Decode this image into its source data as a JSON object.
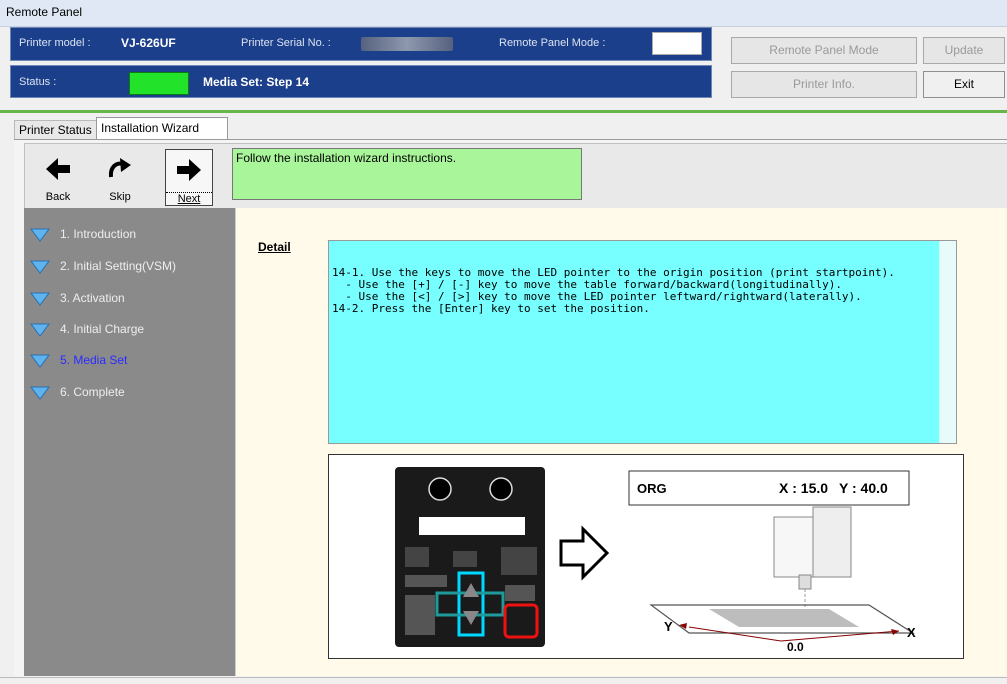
{
  "window": {
    "title": "Remote Panel"
  },
  "header": {
    "printer_model_label": "Printer model :",
    "printer_model_value": "VJ-626UF",
    "serial_label": "Printer Serial No. :",
    "remote_mode_label": "Remote Panel Mode :",
    "status_label": "Status :",
    "status_text": "Media Set: Step 14",
    "status_color": "#22e22a"
  },
  "buttons": {
    "remote_panel_mode": "Remote Panel Mode",
    "update": "Update",
    "printer_info": "Printer Info.",
    "exit": "Exit"
  },
  "tabs": [
    {
      "label": "Printer Status"
    },
    {
      "label": "Installation Wizard"
    }
  ],
  "nav": {
    "back": "Back",
    "skip": "Skip",
    "next": "Next",
    "instruction": "Follow the installation wizard instructions."
  },
  "steps": [
    {
      "label": "1. Introduction"
    },
    {
      "label": "2. Initial Setting(VSM)"
    },
    {
      "label": "3. Activation"
    },
    {
      "label": "4. Initial Charge"
    },
    {
      "label": "5. Media Set"
    },
    {
      "label": "6. Complete"
    }
  ],
  "detail": {
    "heading": "Detail",
    "text": "14-1. Use the keys to move the LED pointer to the origin position (print startpoint).\n  - Use the [+] / [-] key to move the table forward/backward(longitudinally).\n  - Use the [<] / [>] key to move the LED pointer leftward/rightward(laterally).\n14-2. Press the [Enter] key to set the position."
  },
  "figure": {
    "org_label": "ORG",
    "x_readout": "X : 15.0",
    "y_readout": "Y : 40.0",
    "axis_x": "X",
    "axis_y": "Y",
    "origin_value": "0.0"
  }
}
